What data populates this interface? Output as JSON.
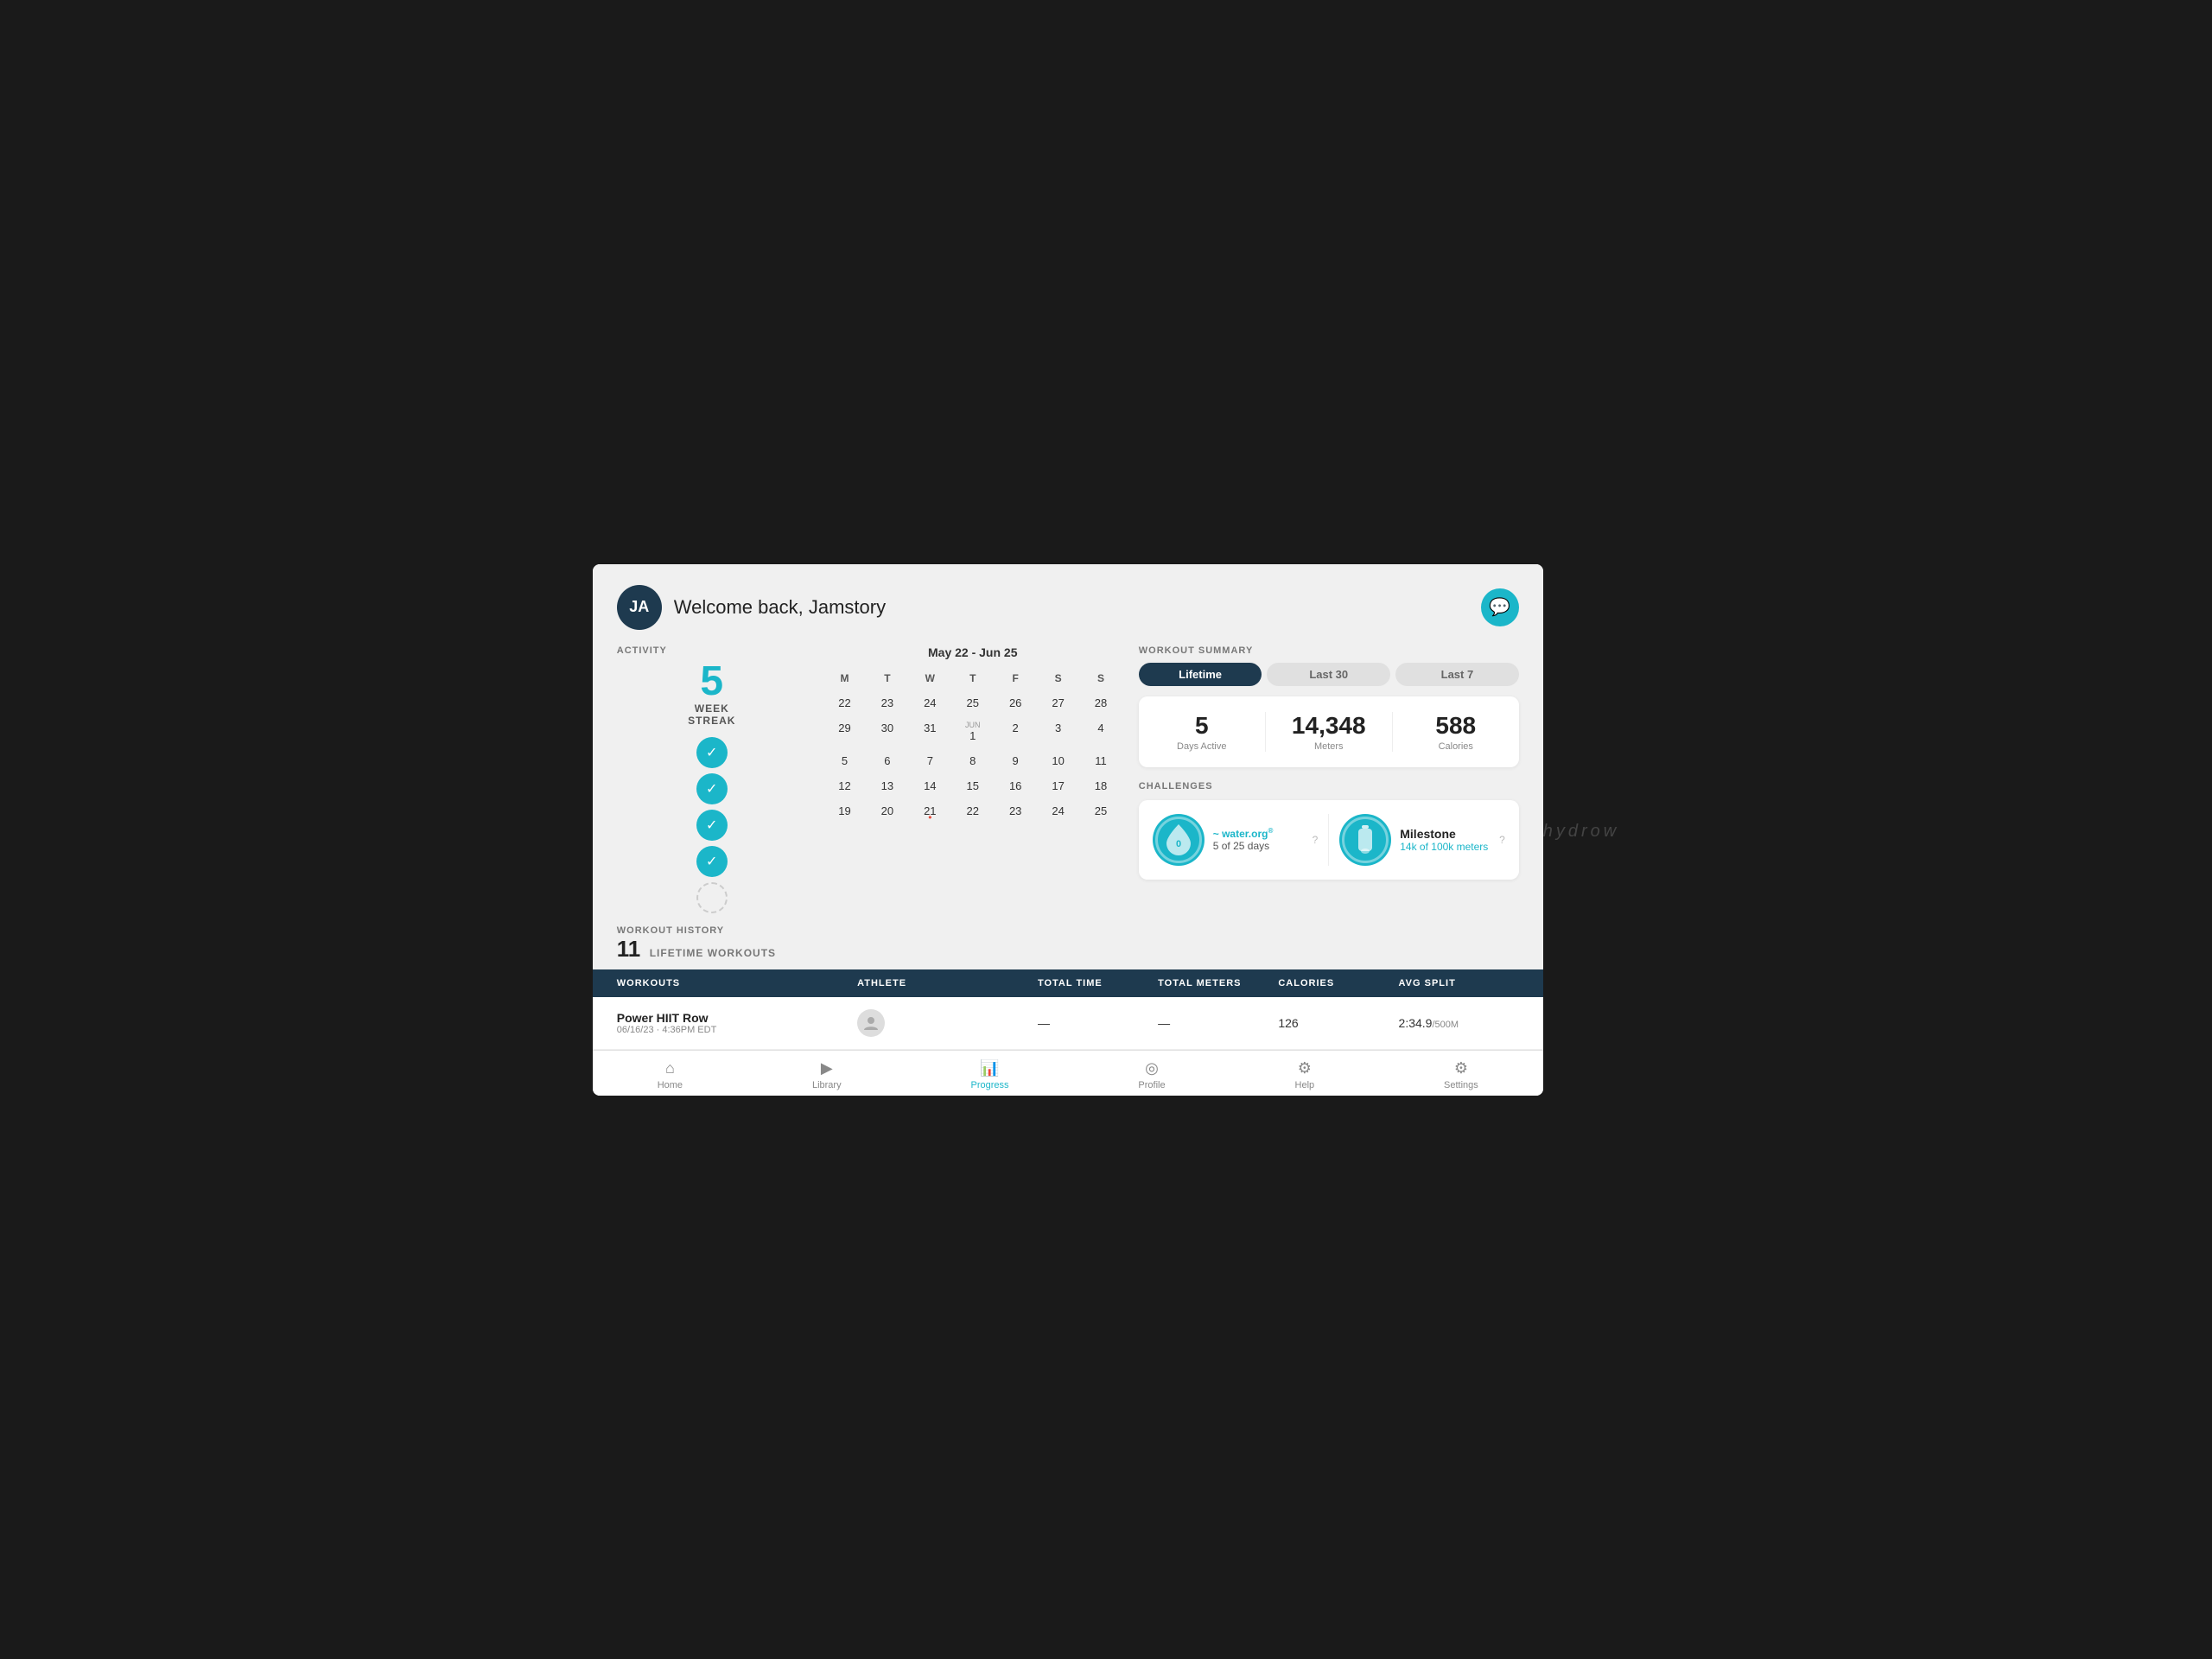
{
  "header": {
    "avatar_initials": "JA",
    "welcome_text": "Welcome back, Jamstory",
    "chat_icon": "💬"
  },
  "activity": {
    "label": "ACTIVITY",
    "streak_number": "5",
    "streak_week_label": "WEEK",
    "streak_streak_label": "STREAK",
    "streak_circles": [
      {
        "checked": true
      },
      {
        "checked": true
      },
      {
        "checked": true
      },
      {
        "checked": true
      },
      {
        "checked": false
      }
    ]
  },
  "calendar": {
    "range_label": "May 22 - Jun 25",
    "days": [
      "M",
      "T",
      "W",
      "T",
      "F",
      "S",
      "S"
    ],
    "rows": [
      [
        {
          "num": "22",
          "highlight": false
        },
        {
          "num": "23",
          "highlight": false
        },
        {
          "num": "24",
          "highlight": false
        },
        {
          "num": "25",
          "highlight": false,
          "sub": ""
        },
        {
          "num": "26",
          "highlight": true,
          "sub": ""
        },
        {
          "num": "27",
          "highlight": false
        },
        {
          "num": "28",
          "highlight": false
        }
      ],
      [
        {
          "num": "29",
          "highlight": false
        },
        {
          "num": "30",
          "highlight": false
        },
        {
          "num": "31",
          "highlight": false
        },
        {
          "num": "1",
          "highlight": false,
          "sub": "JUN"
        },
        {
          "num": "2",
          "highlight": false
        },
        {
          "num": "3",
          "highlight": false
        },
        {
          "num": "4",
          "highlight": true
        }
      ],
      [
        {
          "num": "5",
          "highlight": false
        },
        {
          "num": "6",
          "highlight": false
        },
        {
          "num": "7",
          "highlight": false
        },
        {
          "num": "8",
          "highlight": true
        },
        {
          "num": "9",
          "highlight": false
        },
        {
          "num": "10",
          "highlight": false
        },
        {
          "num": "11",
          "highlight": false
        }
      ],
      [
        {
          "num": "12",
          "highlight": false
        },
        {
          "num": "13",
          "highlight": false
        },
        {
          "num": "14",
          "highlight": false
        },
        {
          "num": "15",
          "highlight": false
        },
        {
          "num": "16",
          "highlight": true
        },
        {
          "num": "17",
          "highlight": false
        },
        {
          "num": "18",
          "highlight": false
        }
      ],
      [
        {
          "num": "19",
          "highlight": false
        },
        {
          "num": "20",
          "highlight": false
        },
        {
          "num": "21",
          "highlight": false,
          "today": true
        },
        {
          "num": "22",
          "highlight": false
        },
        {
          "num": "23",
          "highlight": false
        },
        {
          "num": "24",
          "highlight": false
        },
        {
          "num": "25",
          "highlight": false
        }
      ]
    ]
  },
  "workout_summary": {
    "label": "WORKOUT SUMMARY",
    "tabs": [
      {
        "label": "Lifetime",
        "active": true
      },
      {
        "label": "Last 30",
        "active": false
      },
      {
        "label": "Last 7",
        "active": false
      }
    ],
    "stats": [
      {
        "value": "5",
        "label": "Days Active"
      },
      {
        "value": "14,348",
        "label": "Meters"
      },
      {
        "value": "588",
        "label": "Calories"
      }
    ]
  },
  "challenges": {
    "label": "CHALLENGES",
    "items": [
      {
        "icon": "💧",
        "zero_label": "0",
        "brand": "water.org",
        "progress": "5 of 25 days",
        "q": "?"
      },
      {
        "icon": "🧴",
        "title": "Milestone",
        "subtitle": "14k of 100k meters",
        "q": "?"
      }
    ]
  },
  "workout_history": {
    "label": "WORKOUT HISTORY",
    "count": "11",
    "count_label": "LIFETIME WORKOUTS"
  },
  "table": {
    "headers": [
      "WORKOUTS",
      "ATHLETE",
      "TOTAL TIME",
      "TOTAL METERS",
      "CALORIES",
      "AVG SPLIT"
    ],
    "rows": [
      {
        "title": "Power HIIT Row",
        "date": "06/16/23 · 4:36PM EDT",
        "athlete_icon": "👤",
        "total_time": "—",
        "total_meters": "—",
        "calories": "126",
        "avg_split": "2:34.9",
        "avg_split_unit": "/500M"
      }
    ]
  },
  "bottom_nav": {
    "items": [
      {
        "label": "Home",
        "icon": "⌂",
        "active": false
      },
      {
        "label": "Library",
        "icon": "▶",
        "active": false
      },
      {
        "label": "Progress",
        "icon": "📊",
        "active": true
      },
      {
        "label": "Profile",
        "icon": "◎",
        "active": false
      },
      {
        "label": "Help",
        "icon": "⚙",
        "active": false
      },
      {
        "label": "Settings",
        "icon": "⚙",
        "active": false
      }
    ]
  },
  "watermark": "hydrow"
}
